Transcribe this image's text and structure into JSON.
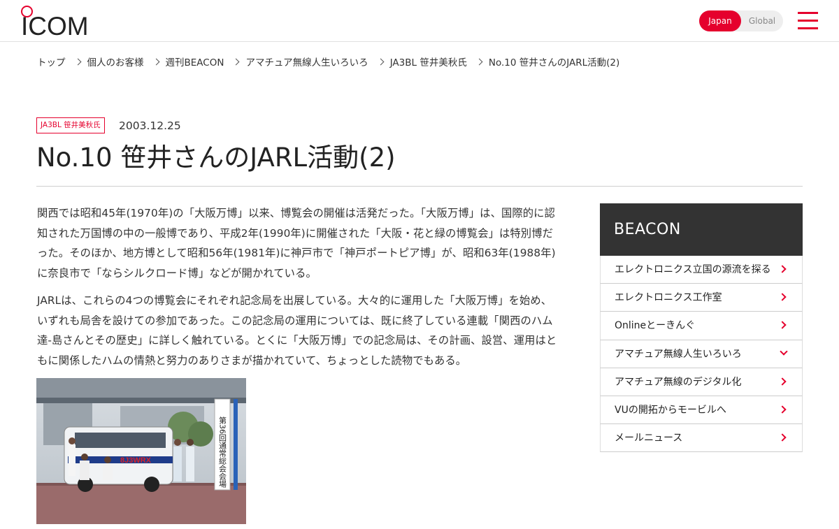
{
  "header": {
    "logo_text": "ICOM",
    "region": {
      "japan_label": "Japan",
      "global_label": "Global"
    },
    "menu_icon": "hamburger-menu-icon"
  },
  "breadcrumb": [
    "トップ",
    "個人のお客様",
    "週刊BEACON",
    "アマチュア無線人生いろいろ",
    "JA3BL 笹井美秋氏",
    "No.10 笹井さんのJARL活動(2)"
  ],
  "article": {
    "tag": "JA3BL 笹井美秋氏",
    "date": "2003.12.25",
    "title": "No.10 笹井さんのJARL活動(2)",
    "paragraphs": [
      "関西では昭和45年(1970年)の「大阪万博」以来、博覧会の開催は活発だった。「大阪万博」は、国際的に認知された万国博の中の一般博であり、平成2年(1990年)に開催された「大阪・花と緑の博覧会」は特別博だった。そのほか、地方博として昭和56年(1981年)に神戸市で「神戸ポートピア博」が、昭和63年(1988年)に奈良市で「ならシルクロード博」などが開かれている。",
      "JARLは、これらの4つの博覧会にそれぞれ記念局を出展している。大々的に運用した「大阪万博」を始め、いずれも局舎を設けての参加であった。この記念局の運用については、既に終了している連載「関西のハム達-島さんとその歴史」に詳しく触れている。とくに「大阪万博」での記念局は、その計画、設営、運用はともに関係したハムの情熱と努力のありさまが描かれていて、ちょっとした読物でもある。"
    ],
    "photo": {
      "van_callsign": "8J3WRX",
      "banner_text": "第36回通常総会会場"
    }
  },
  "sidebar": {
    "heading": "BEACON",
    "items": [
      {
        "label": "エレクトロニクス立国の源流を探る",
        "icon": "chevron-right-icon"
      },
      {
        "label": "エレクトロニクス工作室",
        "icon": "chevron-right-icon"
      },
      {
        "label": "Onlineとーきんぐ",
        "icon": "chevron-right-icon"
      },
      {
        "label": "アマチュア無線人生いろいろ",
        "icon": "chevron-down-icon"
      },
      {
        "label": "アマチュア無線のデジタル化",
        "icon": "chevron-right-icon"
      },
      {
        "label": "VUの開拓からモービルへ",
        "icon": "chevron-right-icon"
      },
      {
        "label": "メールニュース",
        "icon": "chevron-right-icon"
      }
    ]
  },
  "colors": {
    "accent": "#e5002d",
    "sidebar_head": "#333333"
  }
}
